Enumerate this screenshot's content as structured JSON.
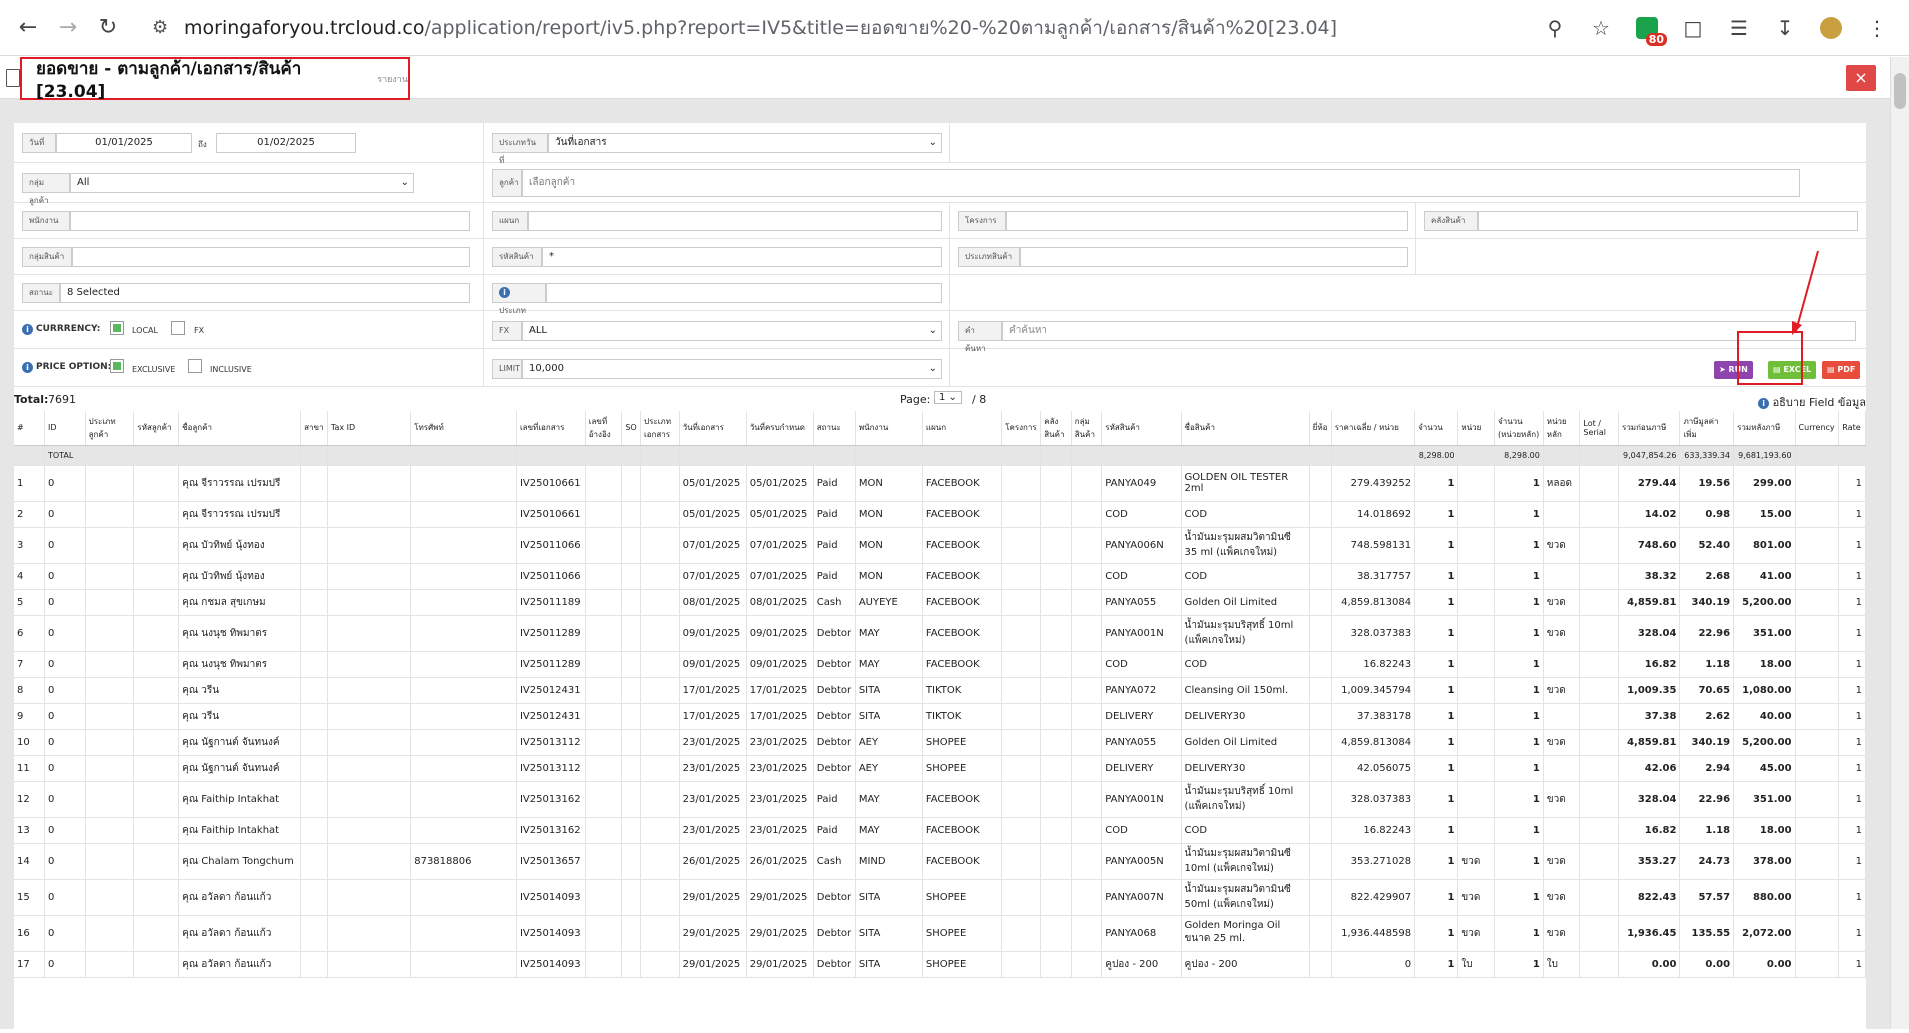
{
  "browser": {
    "url_domain": "moringaforyou.trcloud.co",
    "url_path": "/application/report/iv5.php?report=IV5&title=ยอดขาย%20-%20ตามลูกค้า/เอกสาร/สินค้า%20[23.04]",
    "ext_badge": "80"
  },
  "header": {
    "title": "ยอดขาย - ตามลูกค้า/เอกสาร/สินค้า [23.04]",
    "subtitle": "รายงาน",
    "close": "×"
  },
  "filters": {
    "date_label": "วันที่",
    "date_from": "01/01/2025",
    "to_label": "ถึง",
    "date_to": "01/02/2025",
    "date_type_label": "ประเภทวันที่",
    "date_type_value": "วันที่เอกสาร",
    "customer_group_label": "กลุ่มลูกค้า",
    "customer_group_value": "All",
    "customer_label": "ลูกค้า",
    "customer_placeholder": "เลือกลูกค้า",
    "employee_label": "พนักงาน",
    "department_label": "แผนก",
    "project_label": "โครงการ",
    "warehouse_label": "คลังสินค้า",
    "product_group_label": "กลุ่มสินค้า",
    "product_code_label": "รหัสสินค้า",
    "product_code_value": "*",
    "product_type_label": "ประเภทสินค้า",
    "status_label": "สถานะ",
    "status_value": "8 Selected",
    "type_label": "ประเภท",
    "currency_label": "CURRRENCY:",
    "local_label": "LOCAL",
    "fx_label": "FX",
    "fx_select_label": "FX",
    "fx_select_value": "ALL",
    "keyword_label": "คำค้นหา",
    "keyword_placeholder": "คำค้นหา",
    "price_option_label": "PRICE OPTION:",
    "exclusive_label": "EXCLUSIVE",
    "inclusive_label": "INCLUSIVE",
    "limit_label": "LIMIT",
    "limit_value": "10,000",
    "run_label": "RUN",
    "excel_label": "EXCEL",
    "pdf_label": "PDF"
  },
  "toolbar": {
    "total_label": "Total:",
    "total_value": "7691",
    "page_label": "Page:",
    "page_value": "1",
    "page_of": "/ 8",
    "explain_label": "อธิบาย Field ข้อมูล"
  },
  "table": {
    "headers": [
      "#",
      "ID",
      "ประเภทลูกค้า",
      "รหัสลูกค้า",
      "ชื่อลูกค้า",
      "สาขา",
      "Tax ID",
      "โทรศัพท์",
      "เลขที่เอกสาร",
      "เลขที่อ้างอิง",
      "SO",
      "ประเภทเอกสาร",
      "วันที่เอกสาร",
      "วันที่ครบกำหนด",
      "สถานะ",
      "พนักงาน",
      "แผนก",
      "โครงการ",
      "คลังสินค้า",
      "กลุ่มสินค้า",
      "รหัสสินค้า",
      "ชื่อสินค้า",
      "ยี่ห้อ",
      "ราคาเฉลี่ย / หน่วย",
      "จำนวน",
      "หน่วย",
      "จำนวน (หน่วยหลัก)",
      "หน่วยหลัก",
      "Lot / Serial",
      "รวมก่อนภาษี",
      "ภาษีมูลค่าเพิ่ม",
      "รวมหลังภาษี",
      "Currency",
      "Rate"
    ],
    "total_row": {
      "label": "TOTAL",
      "qty": "8,298.00",
      "qty_main": "8,298.00",
      "before_tax": "9,047,854.26",
      "vat": "633,339.34",
      "after_tax": "9,681,193.60"
    },
    "rows": [
      {
        "n": "1",
        "id": "0",
        "name": "คุณ จีราวรรณ เปรมปรี",
        "tel": "",
        "doc": "IV25010661",
        "date": "05/01/2025",
        "due": "05/01/2025",
        "status": "Paid",
        "emp": "MON",
        "dept": "FACEBOOK",
        "code": "PANYA049",
        "prod": "GOLDEN OIL TESTER 2ml",
        "price": "279.439252",
        "qty": "1",
        "unit": "",
        "qtym": "1",
        "unitm": "หลอด",
        "bt": "279.44",
        "vat": "19.56",
        "at": "299.00",
        "cur": "",
        "rate": "1"
      },
      {
        "n": "2",
        "id": "0",
        "name": "คุณ จีราวรรณ เปรมปรี",
        "tel": "",
        "doc": "IV25010661",
        "date": "05/01/2025",
        "due": "05/01/2025",
        "status": "Paid",
        "emp": "MON",
        "dept": "FACEBOOK",
        "code": "COD",
        "prod": "COD",
        "price": "14.018692",
        "qty": "1",
        "unit": "",
        "qtym": "1",
        "unitm": "",
        "bt": "14.02",
        "vat": "0.98",
        "at": "15.00",
        "cur": "",
        "rate": "1"
      },
      {
        "n": "3",
        "id": "0",
        "name": "คุณ บัวทิพย์ นุ้งทอง",
        "tel": "",
        "doc": "IV25011066",
        "date": "07/01/2025",
        "due": "07/01/2025",
        "status": "Paid",
        "emp": "MON",
        "dept": "FACEBOOK",
        "code": "PANYA006N",
        "prod": "น้ำมันมะรุมผสมวิตามินซี 35 ml (แพ็คเกจใหม่)",
        "price": "748.598131",
        "qty": "1",
        "unit": "",
        "qtym": "1",
        "unitm": "ขวด",
        "bt": "748.60",
        "vat": "52.40",
        "at": "801.00",
        "cur": "",
        "rate": "1"
      },
      {
        "n": "4",
        "id": "0",
        "name": "คุณ บัวทิพย์ นุ้งทอง",
        "tel": "",
        "doc": "IV25011066",
        "date": "07/01/2025",
        "due": "07/01/2025",
        "status": "Paid",
        "emp": "MON",
        "dept": "FACEBOOK",
        "code": "COD",
        "prod": "COD",
        "price": "38.317757",
        "qty": "1",
        "unit": "",
        "qtym": "1",
        "unitm": "",
        "bt": "38.32",
        "vat": "2.68",
        "at": "41.00",
        "cur": "",
        "rate": "1"
      },
      {
        "n": "5",
        "id": "0",
        "name": "คุณ กชมล สุขเกษม",
        "tel": "",
        "doc": "IV25011189",
        "date": "08/01/2025",
        "due": "08/01/2025",
        "status": "Cash",
        "emp": "AUYEYE",
        "dept": "FACEBOOK",
        "code": "PANYA055",
        "prod": "Golden Oil Limited",
        "price": "4,859.813084",
        "qty": "1",
        "unit": "",
        "qtym": "1",
        "unitm": "ขวด",
        "bt": "4,859.81",
        "vat": "340.19",
        "at": "5,200.00",
        "cur": "",
        "rate": "1"
      },
      {
        "n": "6",
        "id": "0",
        "name": "คุณ นงนุช ทิพมาตร",
        "tel": "",
        "doc": "IV25011289",
        "date": "09/01/2025",
        "due": "09/01/2025",
        "status": "Debtor",
        "emp": "MAY",
        "dept": "FACEBOOK",
        "code": "PANYA001N",
        "prod": "น้ำมันมะรุมบริสุทธิ์ 10ml (แพ็คเกจใหม่)",
        "price": "328.037383",
        "qty": "1",
        "unit": "",
        "qtym": "1",
        "unitm": "ขวด",
        "bt": "328.04",
        "vat": "22.96",
        "at": "351.00",
        "cur": "",
        "rate": "1"
      },
      {
        "n": "7",
        "id": "0",
        "name": "คุณ นงนุช ทิพมาตร",
        "tel": "",
        "doc": "IV25011289",
        "date": "09/01/2025",
        "due": "09/01/2025",
        "status": "Debtor",
        "emp": "MAY",
        "dept": "FACEBOOK",
        "code": "COD",
        "prod": "COD",
        "price": "16.82243",
        "qty": "1",
        "unit": "",
        "qtym": "1",
        "unitm": "",
        "bt": "16.82",
        "vat": "1.18",
        "at": "18.00",
        "cur": "",
        "rate": "1"
      },
      {
        "n": "8",
        "id": "0",
        "name": "คุณ วรีน",
        "tel": "",
        "doc": "IV25012431",
        "date": "17/01/2025",
        "due": "17/01/2025",
        "status": "Debtor",
        "emp": "SITA",
        "dept": "TIKTOK",
        "code": "PANYA072",
        "prod": "Cleansing Oil 150ml.",
        "price": "1,009.345794",
        "qty": "1",
        "unit": "",
        "qtym": "1",
        "unitm": "ขวด",
        "bt": "1,009.35",
        "vat": "70.65",
        "at": "1,080.00",
        "cur": "",
        "rate": "1"
      },
      {
        "n": "9",
        "id": "0",
        "name": "คุณ วรีน",
        "tel": "",
        "doc": "IV25012431",
        "date": "17/01/2025",
        "due": "17/01/2025",
        "status": "Debtor",
        "emp": "SITA",
        "dept": "TIKTOK",
        "code": "DELIVERY",
        "prod": "DELIVERY30",
        "price": "37.383178",
        "qty": "1",
        "unit": "",
        "qtym": "1",
        "unitm": "",
        "bt": "37.38",
        "vat": "2.62",
        "at": "40.00",
        "cur": "",
        "rate": "1"
      },
      {
        "n": "10",
        "id": "0",
        "name": "คุณ นัฐกานต์ จันทนงค์",
        "tel": "",
        "doc": "IV25013112",
        "date": "23/01/2025",
        "due": "23/01/2025",
        "status": "Debtor",
        "emp": "AEY",
        "dept": "SHOPEE",
        "code": "PANYA055",
        "prod": "Golden Oil Limited",
        "price": "4,859.813084",
        "qty": "1",
        "unit": "",
        "qtym": "1",
        "unitm": "ขวด",
        "bt": "4,859.81",
        "vat": "340.19",
        "at": "5,200.00",
        "cur": "",
        "rate": "1"
      },
      {
        "n": "11",
        "id": "0",
        "name": "คุณ นัฐกานต์ จันทนงค์",
        "tel": "",
        "doc": "IV25013112",
        "date": "23/01/2025",
        "due": "23/01/2025",
        "status": "Debtor",
        "emp": "AEY",
        "dept": "SHOPEE",
        "code": "DELIVERY",
        "prod": "DELIVERY30",
        "price": "42.056075",
        "qty": "1",
        "unit": "",
        "qtym": "1",
        "unitm": "",
        "bt": "42.06",
        "vat": "2.94",
        "at": "45.00",
        "cur": "",
        "rate": "1"
      },
      {
        "n": "12",
        "id": "0",
        "name": "คุณ Faithip Intakhat",
        "tel": "",
        "doc": "IV25013162",
        "date": "23/01/2025",
        "due": "23/01/2025",
        "status": "Paid",
        "emp": "MAY",
        "dept": "FACEBOOK",
        "code": "PANYA001N",
        "prod": "น้ำมันมะรุมบริสุทธิ์ 10ml (แพ็คเกจใหม่)",
        "price": "328.037383",
        "qty": "1",
        "unit": "",
        "qtym": "1",
        "unitm": "ขวด",
        "bt": "328.04",
        "vat": "22.96",
        "at": "351.00",
        "cur": "",
        "rate": "1"
      },
      {
        "n": "13",
        "id": "0",
        "name": "คุณ Faithip Intakhat",
        "tel": "",
        "doc": "IV25013162",
        "date": "23/01/2025",
        "due": "23/01/2025",
        "status": "Paid",
        "emp": "MAY",
        "dept": "FACEBOOK",
        "code": "COD",
        "prod": "COD",
        "price": "16.82243",
        "qty": "1",
        "unit": "",
        "qtym": "1",
        "unitm": "",
        "bt": "16.82",
        "vat": "1.18",
        "at": "18.00",
        "cur": "",
        "rate": "1"
      },
      {
        "n": "14",
        "id": "0",
        "name": "คุณ Chalam Tongchum",
        "tel": "873818806",
        "doc": "IV25013657",
        "date": "26/01/2025",
        "due": "26/01/2025",
        "status": "Cash",
        "emp": "MIND",
        "dept": "FACEBOOK",
        "code": "PANYA005N",
        "prod": "น้ำมันมะรุมผสมวิตามินซี 10ml (แพ็คเกจใหม่)",
        "price": "353.271028",
        "qty": "1",
        "unit": "ขวด",
        "qtym": "1",
        "unitm": "ขวด",
        "bt": "353.27",
        "vat": "24.73",
        "at": "378.00",
        "cur": "",
        "rate": "1"
      },
      {
        "n": "15",
        "id": "0",
        "name": "คุณ อวัลดา ก้อนแก้ว",
        "tel": "",
        "doc": "IV25014093",
        "date": "29/01/2025",
        "due": "29/01/2025",
        "status": "Debtor",
        "emp": "SITA",
        "dept": "SHOPEE",
        "code": "PANYA007N",
        "prod": "น้ำมันมะรุมผสมวิตามินซี 50ml (แพ็คเกจใหม่)",
        "price": "822.429907",
        "qty": "1",
        "unit": "ขวด",
        "qtym": "1",
        "unitm": "ขวด",
        "bt": "822.43",
        "vat": "57.57",
        "at": "880.00",
        "cur": "",
        "rate": "1"
      },
      {
        "n": "16",
        "id": "0",
        "name": "คุณ อวัลดา ก้อนแก้ว",
        "tel": "",
        "doc": "IV25014093",
        "date": "29/01/2025",
        "due": "29/01/2025",
        "status": "Debtor",
        "emp": "SITA",
        "dept": "SHOPEE",
        "code": "PANYA068",
        "prod": "Golden Moringa Oil ขนาด 25 ml.",
        "price": "1,936.448598",
        "qty": "1",
        "unit": "ขวด",
        "qtym": "1",
        "unitm": "ขวด",
        "bt": "1,936.45",
        "vat": "135.55",
        "at": "2,072.00",
        "cur": "",
        "rate": "1"
      },
      {
        "n": "17",
        "id": "0",
        "name": "คุณ อวัลดา ก้อนแก้ว",
        "tel": "",
        "doc": "IV25014093",
        "date": "29/01/2025",
        "due": "29/01/2025",
        "status": "Debtor",
        "emp": "SITA",
        "dept": "SHOPEE",
        "code": "คูปอง - 200",
        "prod": "คูปอง - 200",
        "price": "0",
        "qty": "1",
        "unit": "ใบ",
        "qtym": "1",
        "unitm": "ใบ",
        "bt": "0.00",
        "vat": "0.00",
        "at": "0.00",
        "cur": "",
        "rate": "1"
      }
    ]
  },
  "colors": {
    "run": "#8e44ad",
    "excel": "#6fbf3a",
    "pdf": "#e74c3c",
    "highlight": "#e01b24"
  }
}
